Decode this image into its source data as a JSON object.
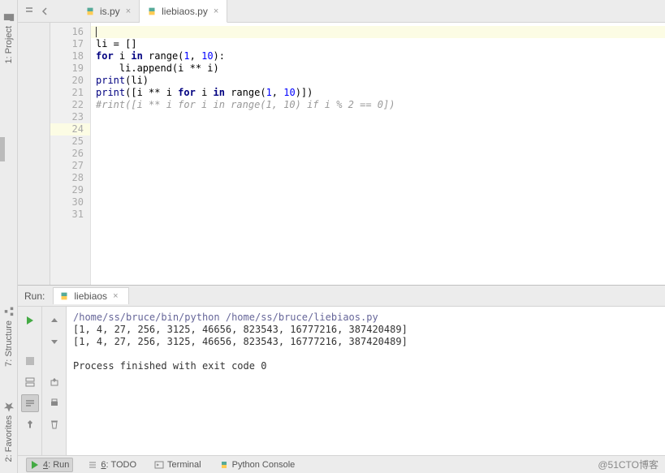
{
  "tabs": [
    {
      "label": "is.py",
      "active": false
    },
    {
      "label": "liebiaos.py",
      "active": true
    }
  ],
  "sidebar": {
    "project": "1: Project",
    "structure": "7: Structure",
    "favorites": "2: Favorites"
  },
  "gutter_start": 16,
  "gutter_end": 31,
  "current_line_no": 24,
  "code": {
    "l24": "",
    "l25": "li = []",
    "l26a": "for",
    "l26b": " i ",
    "l26c": "in",
    "l26d": " range(",
    "l26e": "1",
    "l26f": ", ",
    "l26g": "10",
    "l26h": "):",
    "l27": "    li.append(i ** i)",
    "l28a": "print",
    "l28b": "(li)",
    "l30a": "print",
    "l30b": "([i ** i ",
    "l30c": "for",
    "l30d": " i ",
    "l30e": "in",
    "l30f": " range(",
    "l30g": "1",
    "l30h": ", ",
    "l30i": "10",
    "l30j": ")])",
    "l31": "#rint([i ** i for i in range(1, 10) if i % 2 == 0])"
  },
  "run": {
    "label": "Run:",
    "tab": "liebiaos",
    "cmd": "/home/ss/bruce/bin/python /home/ss/bruce/liebiaos.py",
    "out1": "[1, 4, 27, 256, 3125, 46656, 823543, 16777216, 387420489]",
    "out2": "[1, 4, 27, 256, 3125, 46656, 823543, 16777216, 387420489]",
    "exit": "Process finished with exit code 0"
  },
  "bottom": {
    "run": "4: Run",
    "todo": "6: TODO",
    "terminal": "Terminal",
    "console": "Python Console"
  },
  "watermark": "@51CTO博客"
}
